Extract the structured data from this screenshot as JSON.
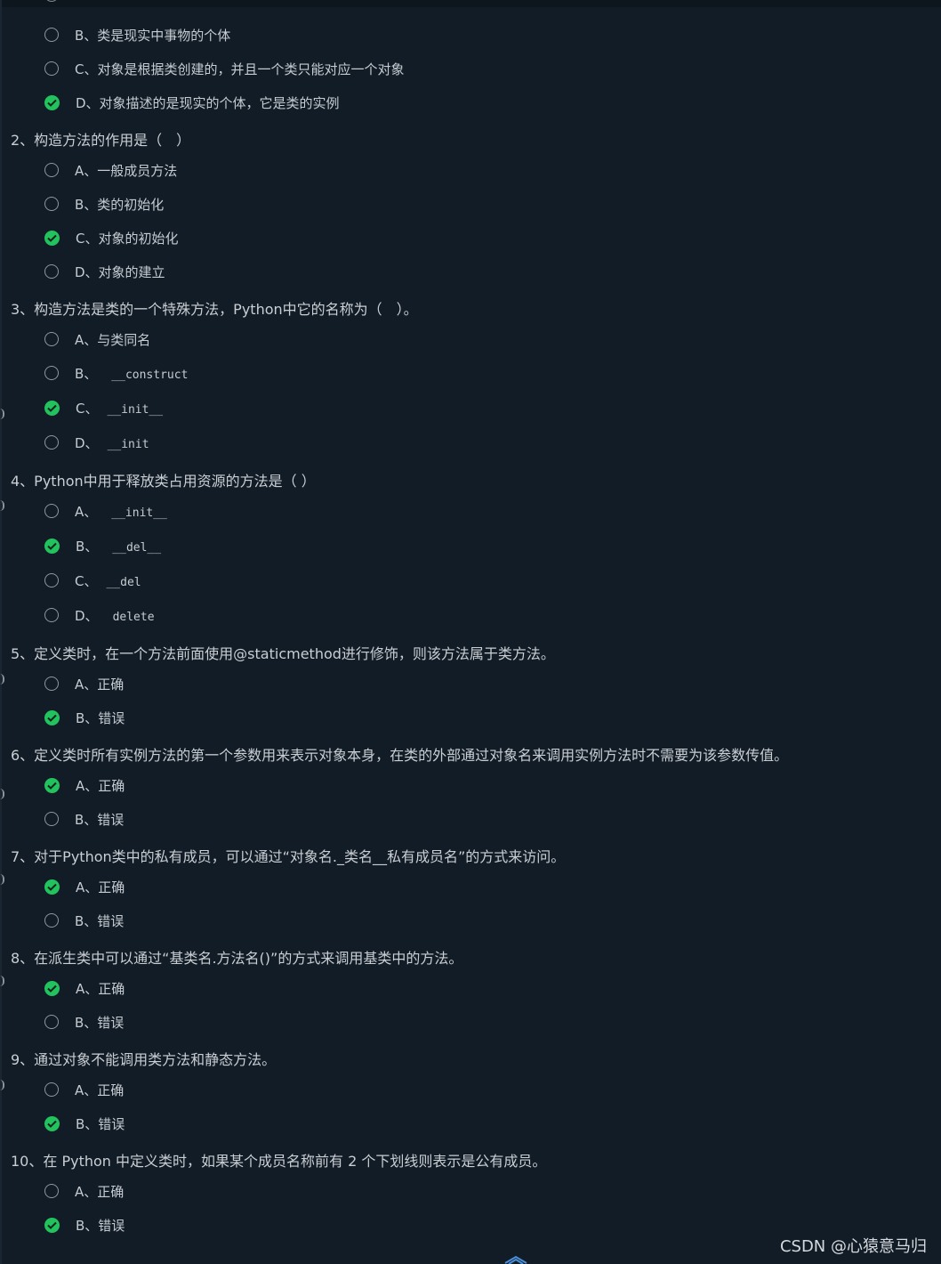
{
  "prev_question_tail": {
    "options": [
      {
        "label": "B、类是现实中事物的个体",
        "checked": false
      },
      {
        "label": "C、对象是根据类创建的，并且一个类只能对应一个对象",
        "checked": false
      },
      {
        "label": "D、对象描述的是现实的个体，它是类的实例",
        "checked": true
      }
    ]
  },
  "questions": [
    {
      "text": "2、构造方法的作用是（　）",
      "options": [
        {
          "prefix": "A、一般成员方法",
          "code": "",
          "checked": false
        },
        {
          "prefix": "B、类的初始化",
          "code": "",
          "checked": false
        },
        {
          "prefix": "C、对象的初始化",
          "code": "",
          "checked": true
        },
        {
          "prefix": "D、对象的建立",
          "code": "",
          "checked": false
        }
      ]
    },
    {
      "text": "3、构造方法是类的一个特殊方法，Python中它的名称为（　）。",
      "options": [
        {
          "prefix": "A、与类同名",
          "code": "",
          "checked": false
        },
        {
          "prefix": "B、",
          "code": "__construct",
          "checked": false
        },
        {
          "prefix": "C、",
          "code": "__init__",
          "checked": true
        },
        {
          "prefix": "D、",
          "code": "__init",
          "checked": false
        }
      ]
    },
    {
      "text": "4、Python中用于释放类占用资源的方法是（ ）",
      "options": [
        {
          "prefix": "A、",
          "code": "__init__",
          "checked": false
        },
        {
          "prefix": "B、",
          "code": "__del__",
          "checked": true
        },
        {
          "prefix": "C、",
          "code": "__del",
          "checked": false
        },
        {
          "prefix": "D、",
          "code": "delete",
          "checked": false
        }
      ]
    },
    {
      "text": "5、定义类时，在一个方法前面使用@staticmethod进行修饰，则该方法属于类方法。",
      "options": [
        {
          "prefix": "A、正确",
          "code": "",
          "checked": false
        },
        {
          "prefix": "B、错误",
          "code": "",
          "checked": true
        }
      ]
    },
    {
      "text": "6、定义类时所有实例方法的第一个参数用来表示对象本身，在类的外部通过对象名来调用实例方法时不需要为该参数传值。",
      "options": [
        {
          "prefix": "A、正确",
          "code": "",
          "checked": true
        },
        {
          "prefix": "B、错误",
          "code": "",
          "checked": false
        }
      ]
    },
    {
      "text": "7、对于Python类中的私有成员，可以通过“对象名._类名__私有成员名”的方式来访问。",
      "options": [
        {
          "prefix": "A、正确",
          "code": "",
          "checked": true
        },
        {
          "prefix": "B、错误",
          "code": "",
          "checked": false
        }
      ]
    },
    {
      "text": "8、在派生类中可以通过“基类名.方法名()”的方式来调用基类中的方法。",
      "options": [
        {
          "prefix": "A、正确",
          "code": "",
          "checked": true
        },
        {
          "prefix": "B、错误",
          "code": "",
          "checked": false
        }
      ]
    },
    {
      "text": "9、通过对象不能调用类方法和静态方法。",
      "options": [
        {
          "prefix": "A、正确",
          "code": "",
          "checked": false
        },
        {
          "prefix": "B、错误",
          "code": "",
          "checked": true
        }
      ]
    },
    {
      "text": "10、在 Python 中定义类时，如果某个成员名称前有 2 个下划线则表示是公有成员。",
      "options": [
        {
          "prefix": "A、正确",
          "code": "",
          "checked": false
        },
        {
          "prefix": "B、错误",
          "code": "",
          "checked": true
        }
      ]
    }
  ],
  "watermark": "CSDN @心猿意马归",
  "colors": {
    "background": "#121c26",
    "check_green": "#22c35e",
    "text": "#c9ced3",
    "radio_border": "#8f979f"
  },
  "icons": {
    "checked": "check-circle-icon",
    "unchecked": "radio-empty-icon",
    "scroll": "scroll-up-icon"
  }
}
